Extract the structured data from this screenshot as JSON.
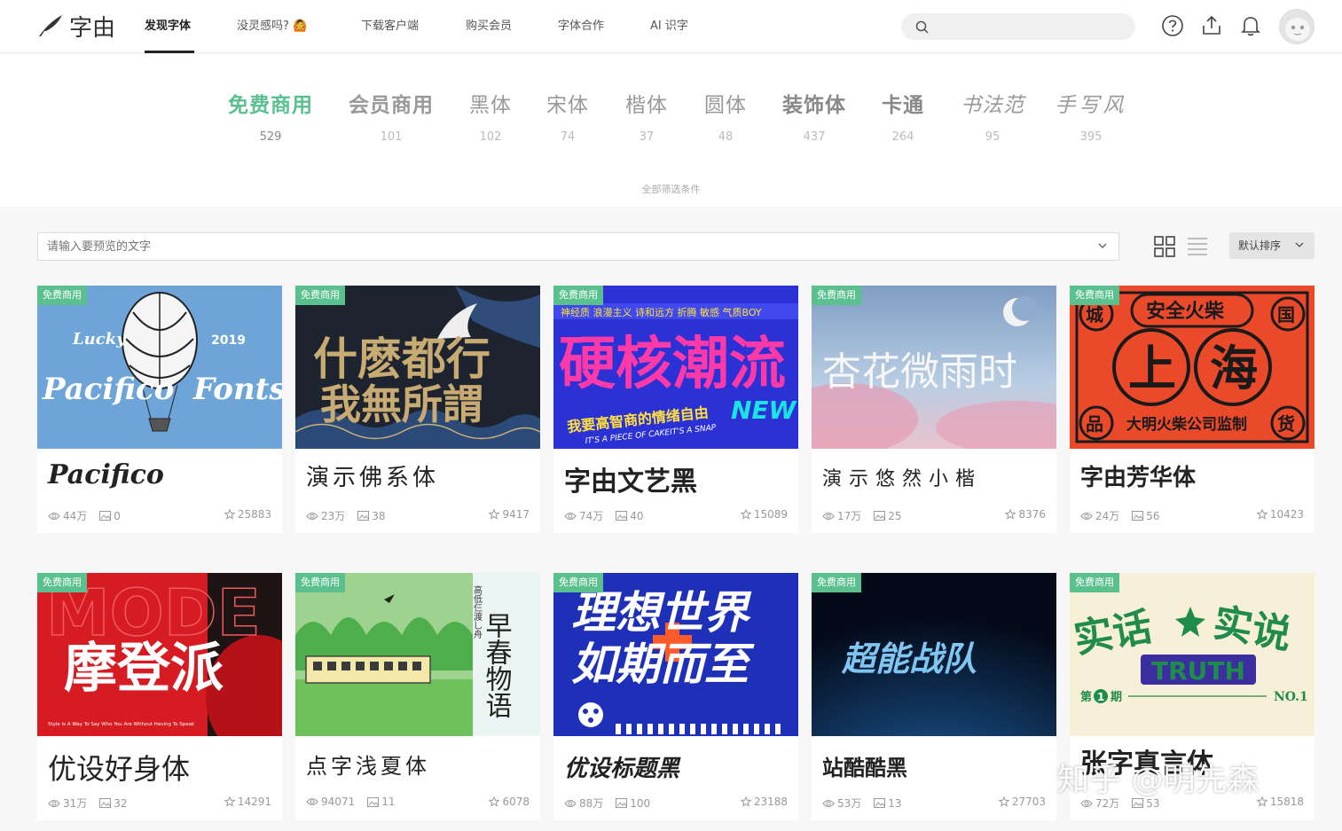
{
  "header": {
    "logo_text": "字由",
    "nav": [
      {
        "label": "发现字体",
        "active": true
      },
      {
        "label": "没灵感吗? 🙆"
      },
      {
        "label": "下载客户端"
      },
      {
        "label": "购买会员"
      },
      {
        "label": "字体合作"
      },
      {
        "label": "AI 识字"
      }
    ],
    "search_value": ""
  },
  "categories": [
    {
      "label": "免费商用",
      "count": "529",
      "active": true
    },
    {
      "label": "会员商用",
      "count": "101"
    },
    {
      "label": "黑体",
      "count": "102"
    },
    {
      "label": "宋体",
      "count": "74"
    },
    {
      "label": "楷体",
      "count": "37"
    },
    {
      "label": "圆体",
      "count": "48"
    },
    {
      "label": "装饰体",
      "count": "437"
    },
    {
      "label": "卡通",
      "count": "264"
    },
    {
      "label": "书法范",
      "count": "95"
    },
    {
      "label": "手写风",
      "count": "395"
    }
  ],
  "filter_link": "全部筛选条件",
  "toolbar": {
    "preview_placeholder": "请输入要预览的文字",
    "sort_label": "默认排序"
  },
  "cards": [
    {
      "badge": "免费商用",
      "name": "Pacifico",
      "views": "44万",
      "images": "0",
      "stars": "25883",
      "art": {
        "main": "Pacifico",
        "left": "Lucky",
        "right": "Fonts",
        "year": "2019"
      }
    },
    {
      "badge": "免费商用",
      "name": "演示佛系体",
      "views": "23万",
      "images": "38",
      "stars": "9417",
      "art": {
        "main": "什麽都行",
        "sub": "我無所謂"
      }
    },
    {
      "badge": "免费商用",
      "name": "字由文艺黑",
      "views": "74万",
      "images": "40",
      "stars": "15089",
      "art": {
        "top": "神经质 浪漫主义 诗和远方 折腾 敏感 气质BOY",
        "main": "硬核潮流",
        "sub": "我要高智商的情绪自由",
        "new": "NEW",
        "en": "IT'S A PIECE OF CAKEIT'S A SNAP"
      }
    },
    {
      "badge": "免费商用",
      "name": "演示悠然小楷",
      "views": "17万",
      "images": "25",
      "stars": "8376",
      "art": {
        "main": "杏花微雨时"
      }
    },
    {
      "badge": "免费商用",
      "name": "字由芳华体",
      "views": "24万",
      "images": "56",
      "stars": "10423",
      "art": {
        "top": "安全火柴",
        "left": "上",
        "right": "海",
        "bl": "品",
        "br": "货",
        "tl": "城",
        "tr": "国",
        "bottom": "大明火柴公司监制"
      }
    },
    {
      "badge": "免费商用",
      "name": "优设好身体",
      "views": "31万",
      "images": "32",
      "stars": "14291",
      "art": {
        "bg": "MODE",
        "main": "摩登派",
        "en": "Style Is A Way To Say Who You Are Without Having To Speak"
      }
    },
    {
      "badge": "免费商用",
      "name": "点字浅夏体",
      "views": "94071",
      "images": "11",
      "stars": "6078",
      "art": {
        "main": "早春物语",
        "small": "高低仨渡乚舟"
      }
    },
    {
      "badge": "免费商用",
      "name": "优设标题黑",
      "views": "88万",
      "images": "100",
      "stars": "23188",
      "art": {
        "l1": "理想世界",
        "l2": "如期而至"
      }
    },
    {
      "badge": "免费商用",
      "name": "站酷酷黑",
      "views": "53万",
      "images": "13",
      "stars": "27703",
      "art": {
        "main": "超能战队"
      }
    },
    {
      "badge": "免费商用",
      "name": "张字真言体",
      "views": "72万",
      "images": "53",
      "stars": "15818",
      "art": {
        "left": "实话",
        "right": "实说",
        "band": "TRUTH",
        "issue": "第",
        "num": "1",
        "period": "期",
        "no": "NO.1"
      }
    }
  ],
  "watermark": "知乎 @明先森"
}
